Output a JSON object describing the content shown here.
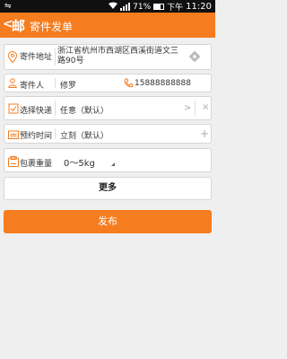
{
  "status": {
    "signal_glyph": "⇋",
    "battery": "71%",
    "ampm": "下午",
    "time": "11:20"
  },
  "header": {
    "back": "<",
    "logo": "邮",
    "title": "寄件发单"
  },
  "address": {
    "label": "寄件地址",
    "value": "浙江省杭州市西湖区西溪街道文三路90号"
  },
  "sender": {
    "label": "寄件人",
    "name": "修罗",
    "phone": "15888888888"
  },
  "courier": {
    "label": "选择快递",
    "value": "任意（默认）",
    "arrow": ">",
    "clear": "×"
  },
  "appointment": {
    "label": "预约时间",
    "value": "立刻（默认）",
    "add": "+"
  },
  "weight": {
    "label": "包裹重量",
    "value": "0～5kg"
  },
  "more_label": "更多",
  "publish_label": "发布",
  "colors": {
    "accent": "#f57c1f",
    "background": "#efefef"
  }
}
